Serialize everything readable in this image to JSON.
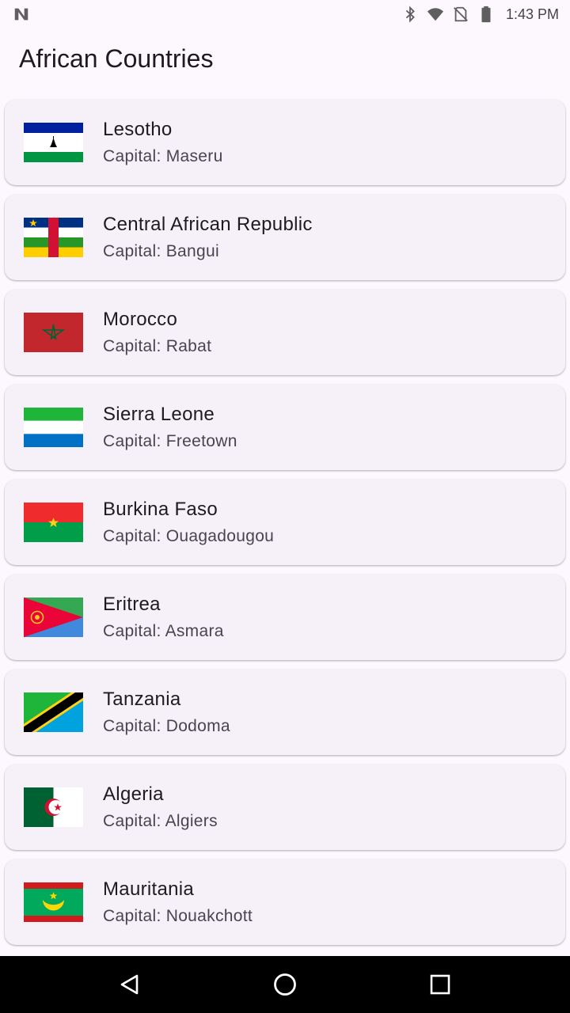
{
  "status_bar": {
    "time": "1:43 PM",
    "icons": [
      "app-notification-icon",
      "bluetooth-icon",
      "wifi-icon",
      "no-sim-icon",
      "battery-icon"
    ]
  },
  "app": {
    "title": "African Countries"
  },
  "countries": [
    {
      "name": "Lesotho",
      "capital": "Capital: Maseru",
      "flag_icon": "lesotho-flag-icon"
    },
    {
      "name": "Central African Republic",
      "capital": "Capital: Bangui",
      "flag_icon": "central-african-republic-flag-icon"
    },
    {
      "name": "Morocco",
      "capital": "Capital: Rabat",
      "flag_icon": "morocco-flag-icon"
    },
    {
      "name": "Sierra Leone",
      "capital": "Capital: Freetown",
      "flag_icon": "sierra-leone-flag-icon"
    },
    {
      "name": "Burkina Faso",
      "capital": "Capital: Ouagadougou",
      "flag_icon": "burkina-faso-flag-icon"
    },
    {
      "name": "Eritrea",
      "capital": "Capital: Asmara",
      "flag_icon": "eritrea-flag-icon"
    },
    {
      "name": "Tanzania",
      "capital": "Capital: Dodoma",
      "flag_icon": "tanzania-flag-icon"
    },
    {
      "name": "Algeria",
      "capital": "Capital: Algiers",
      "flag_icon": "algeria-flag-icon"
    },
    {
      "name": "Mauritania",
      "capital": "Capital: Nouakchott",
      "flag_icon": "mauritania-flag-icon"
    }
  ],
  "nav_bar": {
    "icons": [
      "back-icon",
      "home-icon",
      "recents-icon"
    ]
  },
  "colors": {
    "background": "#fdf7fe",
    "card": "#f6f1f8",
    "title_text": "#1d1b20",
    "secondary_text": "#49454f",
    "nav_bar": "#000000"
  }
}
